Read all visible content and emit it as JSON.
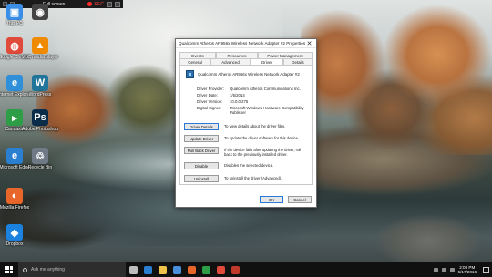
{
  "recorder": {
    "title": "Full screen",
    "state": "REC"
  },
  "desktop": {
    "icons": [
      {
        "label": "This PC",
        "icon": "this-pc-icon",
        "color": "#3a8ee6",
        "glyph": "▣"
      },
      {
        "label": "",
        "icon": "camera-icon",
        "color": "#444444",
        "glyph": "◉"
      },
      {
        "label": "Google Chrome",
        "icon": "chrome-icon",
        "color": "#e04a3a",
        "glyph": "◍"
      },
      {
        "label": "VLC media player",
        "icon": "vlc-icon",
        "color": "#f08a00",
        "glyph": "▲"
      },
      {
        "label": "Internet Explorer",
        "icon": "internet-explorer-icon",
        "color": "#2f8fd8",
        "glyph": "e"
      },
      {
        "label": "WordPress",
        "icon": "wordpress-icon",
        "color": "#21759b",
        "glyph": "W"
      },
      {
        "label": "Camtasia",
        "icon": "camtasia-icon",
        "color": "#2e9e46",
        "glyph": "▸"
      },
      {
        "label": "Adobe Photoshop",
        "icon": "photoshop-icon",
        "color": "#0b2d4a",
        "glyph": "Ps"
      },
      {
        "label": "Microsoft Edge",
        "icon": "edge-icon",
        "color": "#2b7fd1",
        "glyph": "e"
      },
      {
        "label": "Recycle Bin",
        "icon": "recycle-bin-icon",
        "color": "#6f7a86",
        "glyph": "♲"
      },
      {
        "label": "Mozilla Firefox",
        "icon": "firefox-icon",
        "color": "#e8662a",
        "glyph": "◐"
      },
      {
        "label": "Dropbox",
        "icon": "dropbox-icon",
        "color": "#1b82e0",
        "glyph": "◆"
      }
    ]
  },
  "dialog": {
    "title": "Qualcomm Atheros AR956x Wireless Network Adapter #2 Properties",
    "close": "✕",
    "tabs_top": [
      "Events",
      "Resources",
      "Power Management"
    ],
    "tabs_bottom": [
      "General",
      "Advanced",
      "Driver",
      "Details"
    ],
    "active_tab": "Driver",
    "device_name": "Qualcomm Atheros AR956x Wireless Network Adapter #2",
    "properties": [
      {
        "key": "Driver Provider:",
        "value": "Qualcomm Atheros Communications Inc."
      },
      {
        "key": "Driver Date:",
        "value": "1/6/2014"
      },
      {
        "key": "Driver Version:",
        "value": "10.0.0.275"
      },
      {
        "key": "Digital Signer:",
        "value": "Microsoft Windows Hardware Compatibility Publisher"
      }
    ],
    "actions": [
      {
        "button": "Driver Details",
        "desc": "To view details about the driver files."
      },
      {
        "button": "Update Driver",
        "desc": "To update the driver software for this device."
      },
      {
        "button": "Roll Back Driver",
        "desc": "If the device fails after updating the driver, roll back to the previously installed driver."
      },
      {
        "button": "Disable",
        "desc": "Disables the selected device."
      },
      {
        "button": "Uninstall",
        "desc": "To uninstall the driver (Advanced)."
      }
    ],
    "ok": "OK",
    "cancel": "Cancel"
  },
  "taskbar": {
    "search_placeholder": "Ask me anything",
    "apps": [
      {
        "icon": "task-view-icon",
        "color": "#bdbdbd"
      },
      {
        "icon": "edge-icon",
        "color": "#2b7fd1"
      },
      {
        "icon": "file-explorer-icon",
        "color": "#f1c24a"
      },
      {
        "icon": "store-icon",
        "color": "#4a8fdc"
      },
      {
        "icon": "firefox-icon",
        "color": "#e8662a"
      },
      {
        "icon": "camtasia-icon",
        "color": "#2e9e46"
      },
      {
        "icon": "chrome-icon",
        "color": "#e04a3a"
      },
      {
        "icon": "recorder-icon",
        "color": "#c0392b"
      }
    ],
    "time": "2:08 PM",
    "date": "5/17/2016"
  }
}
